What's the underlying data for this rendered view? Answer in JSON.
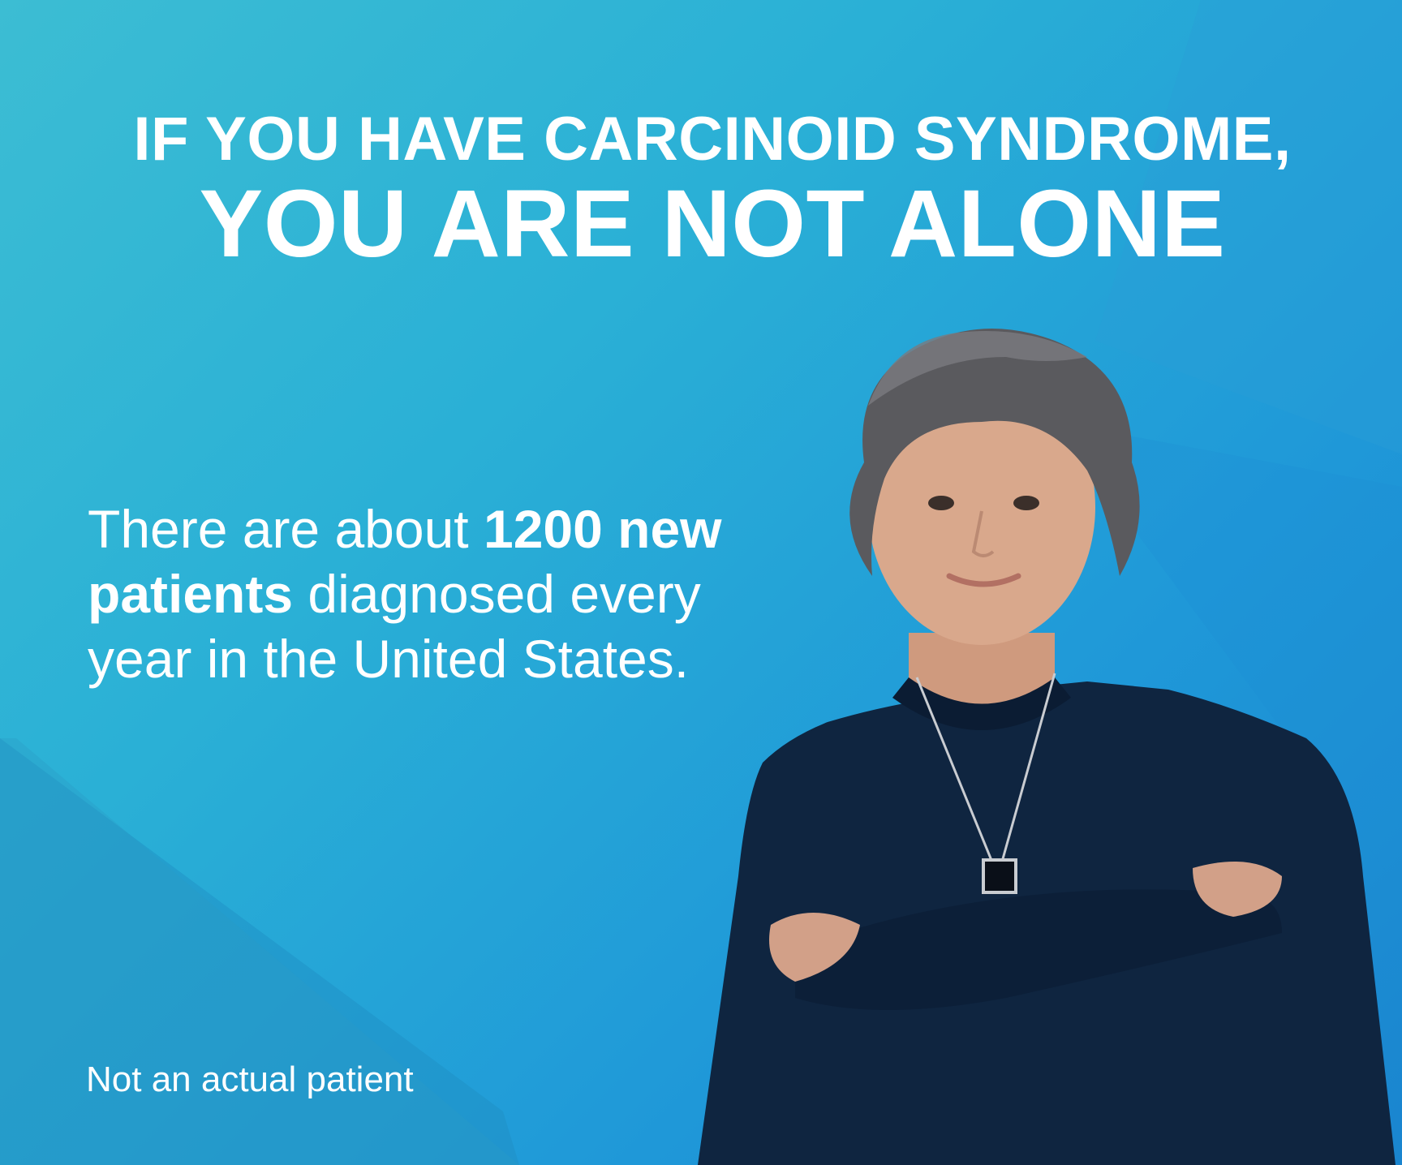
{
  "headline": {
    "line1": "IF YOU HAVE CARCINOID SYNDROME,",
    "line2": "YOU ARE NOT ALONE"
  },
  "body": {
    "lead": "There are about ",
    "highlight": "1200 new patients",
    "rest": " diagnosed every year in the United States."
  },
  "disclaimer": "Not an actual patient",
  "colors": {
    "background_top": "#3cbdd3",
    "background_bottom": "#1a85cf",
    "text": "#ffffff",
    "hair": "#5a5a5e",
    "shirt": "#0f2540",
    "skin": "#d9a88c"
  }
}
